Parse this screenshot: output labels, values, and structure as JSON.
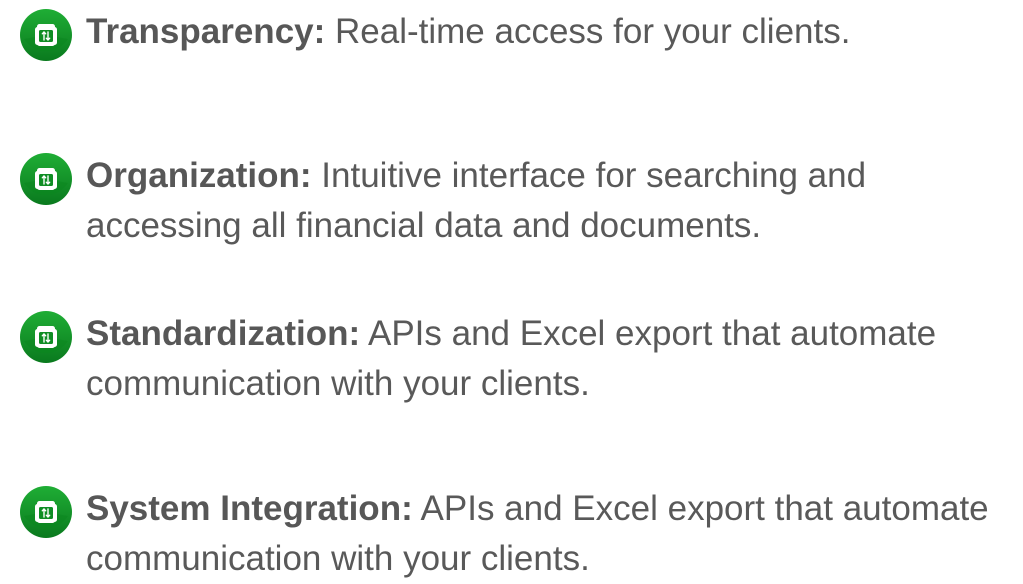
{
  "features": [
    {
      "title": "Transparency:",
      "description": "Real-time access for your clients.",
      "icon": "wallet-transfer-icon"
    },
    {
      "title": "Organization:",
      "description": "Intuitive interface for searching and accessing all financial data and documents.",
      "icon": "wallet-transfer-icon"
    },
    {
      "title": "Standardization:",
      "description": "APIs and Excel export that automate communication with your clients.",
      "icon": "wallet-transfer-icon"
    },
    {
      "title": "System Integration:",
      "description": "APIs and Excel export that automate communication with your clients.",
      "icon": "wallet-transfer-icon"
    }
  ],
  "colors": {
    "icon_green_dark": "#0a7a1e",
    "icon_green_light": "#1ea832",
    "text": "#595959"
  }
}
